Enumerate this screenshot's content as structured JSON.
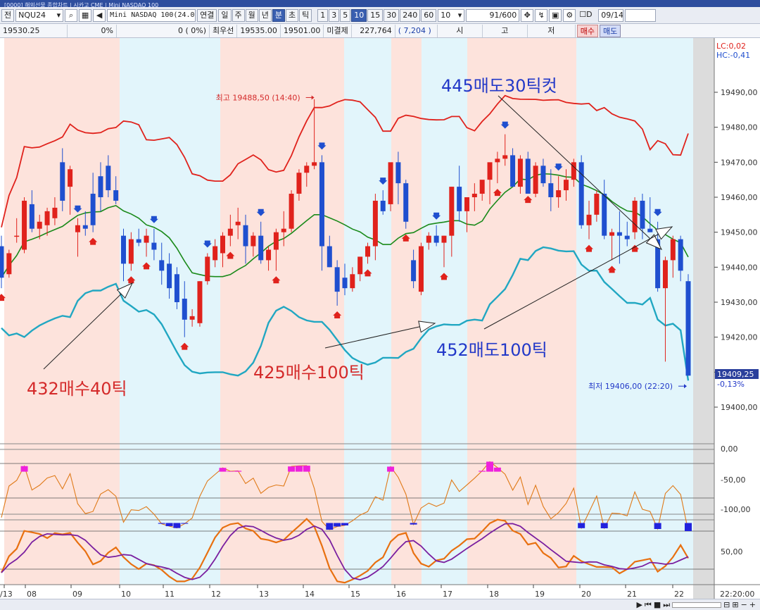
{
  "window": {
    "title_bar": "[0000] 해외선물 종합차트 | 시카고 CME | Mini NASDAQ 100"
  },
  "toolbar": {
    "prefix": "전",
    "symbol": "NQU24",
    "product": "Mini NASDAQ 100(24.0",
    "link_label": "연결",
    "period_buttons": [
      "일",
      "주",
      "월",
      "년",
      "분",
      "초",
      "틱"
    ],
    "active_period": "분",
    "interval_buttons": [
      "1",
      "3",
      "5",
      "10",
      "15",
      "30",
      "240",
      "60"
    ],
    "active_interval": "10",
    "interval_input": "10",
    "count": "91",
    "count_total": "/600",
    "checkbox_label": "D",
    "date": "09/14"
  },
  "infobar": {
    "price": "19530.25",
    "change_pct": "0%",
    "volume_info": "0 (   0%)",
    "best_bid_label": "최우선",
    "best_ask": "19535.00",
    "best_bid": "19501.00",
    "open_interest_label": "미결제",
    "open_interest": "227,764",
    "oi_change": "7,204",
    "ohlc_labels": [
      "시",
      "고",
      "저"
    ],
    "buy_label": "매수",
    "sell_label": "매도"
  },
  "chart_data": {
    "type": "candlestick",
    "price_axis": {
      "range": [
        19395,
        19502
      ],
      "ticks": [
        "19490,00",
        "19480,00",
        "19470,00",
        "19460,00",
        "19450,00",
        "19440,00",
        "19430,00",
        "19420,00",
        "19410,00",
        "19400,00"
      ],
      "last_price_label": "19409,25",
      "last_change_label": "-0,13%",
      "lc_label": "LC:0,02",
      "hc_label": "HC:-0,41"
    },
    "time_axis": {
      "ticks": [
        "/13",
        "08",
        "09",
        "10",
        "11",
        "12",
        "13",
        "14",
        "15",
        "16",
        "17",
        "18",
        "19",
        "20",
        "21",
        "22"
      ],
      "end_label": "22:20:00"
    },
    "high_label": "최고 19488,50 (14:40)",
    "low_label": "최저 19406,00 (22:20)",
    "annotations": [
      {
        "text": "432매수40틱",
        "color": "#d42a2a"
      },
      {
        "text": "425매수100틱",
        "color": "#d42a2a"
      },
      {
        "text": "445매도30틱컷",
        "color": "#2238c8"
      },
      {
        "text": "452매도100틱",
        "color": "#2238c8"
      }
    ],
    "osc1_ticks": [
      "0,00",
      "-50,00",
      "-100,00"
    ],
    "osc2_ticks": [
      "50,00"
    ],
    "colors": {
      "up": "#e0221c",
      "down": "#1f4fcf",
      "upper_band": "#e0221c",
      "middle_band": "#1a8a1a",
      "lower_band": "#21a7c2",
      "zone_pink": "#fde3dc",
      "zone_blue": "#e2f5fb"
    }
  },
  "statusbar": {
    "icons": [
      "play-icon",
      "prev-icon",
      "stop-icon",
      "next-icon",
      "zoom-out-icon",
      "zoom-in-icon",
      "add-icon"
    ]
  }
}
